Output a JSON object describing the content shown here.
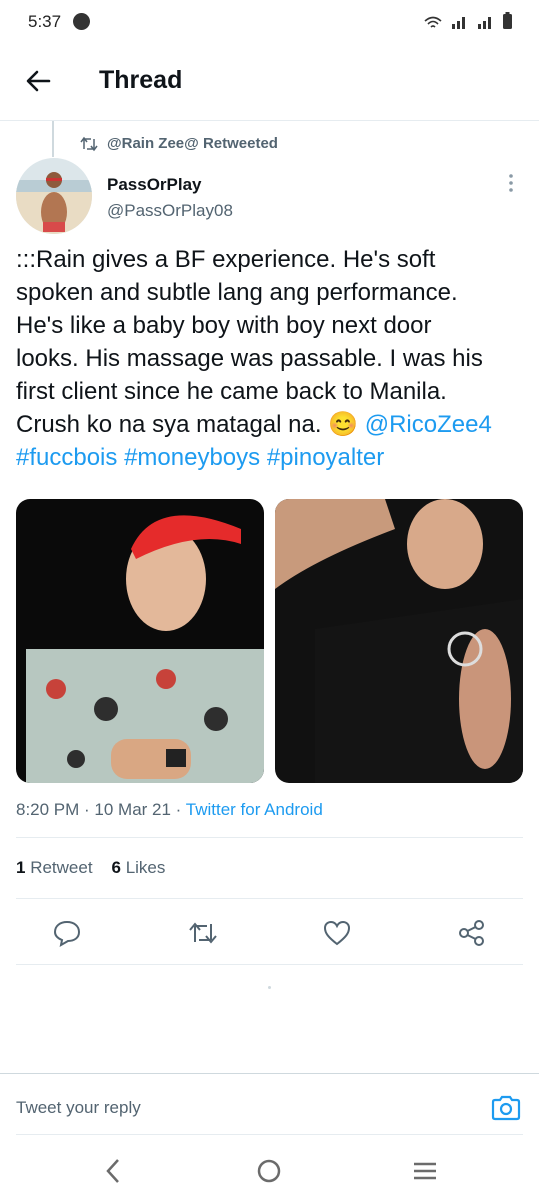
{
  "status": {
    "time": "5:37"
  },
  "header": {
    "title": "Thread"
  },
  "retweet": {
    "label": "@Rain Zee@ Retweeted"
  },
  "tweet": {
    "author_name": "PassOrPlay",
    "author_handle": "@PassOrPlay08",
    "text_line1": ":::Rain gives a BF experience. He's soft",
    "text_line2": "spoken and subtle lang ang performance.",
    "text_line3": "He's like a baby boy with boy next door",
    "text_line4": "looks. His massage was passable. I was his",
    "text_line5": "first client since he came back to Manila.",
    "text_line6": "Crush ko na sya matagal na. ",
    "emoji": "😊",
    "mention": "@RicoZee4",
    "hashtag1": "#fuccbois",
    "hashtag2": "#moneyboys",
    "hashtag3": "#pinoyalter",
    "time": "8:20 PM · 10 Mar 21 · ",
    "source": "Twitter for Android"
  },
  "stats": {
    "retweets_count": "1",
    "retweets_label": "Retweet",
    "likes_count": "6",
    "likes_label": "Likes"
  },
  "reply": {
    "placeholder": "Tweet your reply"
  },
  "colors": {
    "accent": "#1d9bf0",
    "text": "#0f1419",
    "muted": "#536471"
  },
  "icons": [
    "back-arrow-icon",
    "retweet-icon",
    "more-vertical-icon",
    "reply-icon",
    "retweet-action-icon",
    "like-icon",
    "share-icon",
    "camera-icon",
    "nav-back-icon",
    "nav-home-icon",
    "nav-menu-icon"
  ]
}
